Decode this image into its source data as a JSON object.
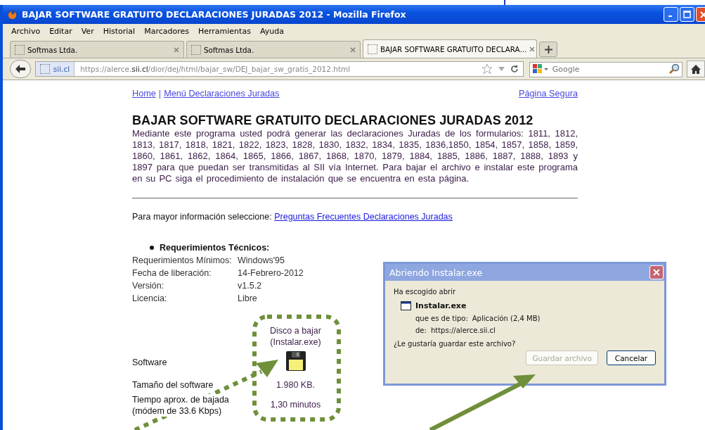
{
  "window": {
    "title": "BAJAR SOFTWARE GRATUITO DECLARACIONES JURADAS 2012 - Mozilla Firefox"
  },
  "menu": [
    "Archivo",
    "Editar",
    "Ver",
    "Historial",
    "Marcadores",
    "Herramientas",
    "Ayuda"
  ],
  "tabs": [
    {
      "label": "Softmas Ltda.",
      "selected": false
    },
    {
      "label": "Softmas Ltda.",
      "selected": false
    },
    {
      "label": "BAJAR SOFTWARE GRATUITO DECLARA...",
      "selected": true
    }
  ],
  "address": {
    "site": "sii.cl",
    "url_prefix": "https://alerce.",
    "url_domain": "sii.cl",
    "url_path": "/dior/dej/html/bajar_sw/DEJ_bajar_sw_gratis_2012.html"
  },
  "search": {
    "placeholder": "Google"
  },
  "page": {
    "nav_links": [
      "Home",
      "Menú Declaraciones Juradas"
    ],
    "nav_separator": "|",
    "secure_link": "Página Segura",
    "heading": "BAJAR SOFTWARE GRATUITO DECLARACIONES JURADAS 2012",
    "intro": "Mediante este programa usted podrá generar las declaraciones Juradas de los formularios: 1811, 1812, 1813, 1817, 1818, 1821, 1822, 1823, 1828, 1830, 1832, 1834, 1835, 1836,1850, 1854, 1857, 1858, 1859, 1860, 1861, 1862, 1864, 1865, 1866, 1867, 1868, 1870, 1879, 1884, 1885, 1886, 1887, 1888, 1893 y 1897 para que puedan ser transmitidas al SII vía Internet. Para bajar el archivo e instalar este programa en su PC siga el procedimiento de instalación que se encuentra en esta página.",
    "more_info": "Para mayor información seleccione:",
    "faq_link": "Preguntas Frecuentes Declaraciones Juradas",
    "requirements_title": "Requerimientos Técnicos:",
    "specs": [
      {
        "label": "Requerimientos Mínimos:",
        "value": "Windows'95"
      },
      {
        "label": "Fecha de liberación:",
        "value": "14-Febrero-2012"
      },
      {
        "label": "Versión:",
        "value": "v1.5.2"
      },
      {
        "label": "Licencia:",
        "value": "Libre"
      }
    ],
    "download": {
      "header": [
        "Disco a bajar",
        "(Instalar.exe)"
      ],
      "software_label": "Software",
      "size_label": "Tamaño del software",
      "size": "1.980 KB.",
      "time_label": [
        "Tiempo aprox. de bajada",
        "(módem de 33.6 Kbps)"
      ],
      "time": "1,30 minutos"
    }
  },
  "dialog": {
    "title": "Abriendo Instalar.exe",
    "intro": "Ha escogido abrir",
    "file": "Instalar.exe",
    "type_label": "que es de tipo:",
    "type": "Aplicación (2,4 MB)",
    "from_label": "de:",
    "from": "https://alerce.sii.cl",
    "question": "¿Le gustaría guardar este archivo?",
    "buttons": [
      {
        "label": "Guardar archivo",
        "disabled": true
      },
      {
        "label": "Cancelar",
        "disabled": false
      }
    ]
  }
}
